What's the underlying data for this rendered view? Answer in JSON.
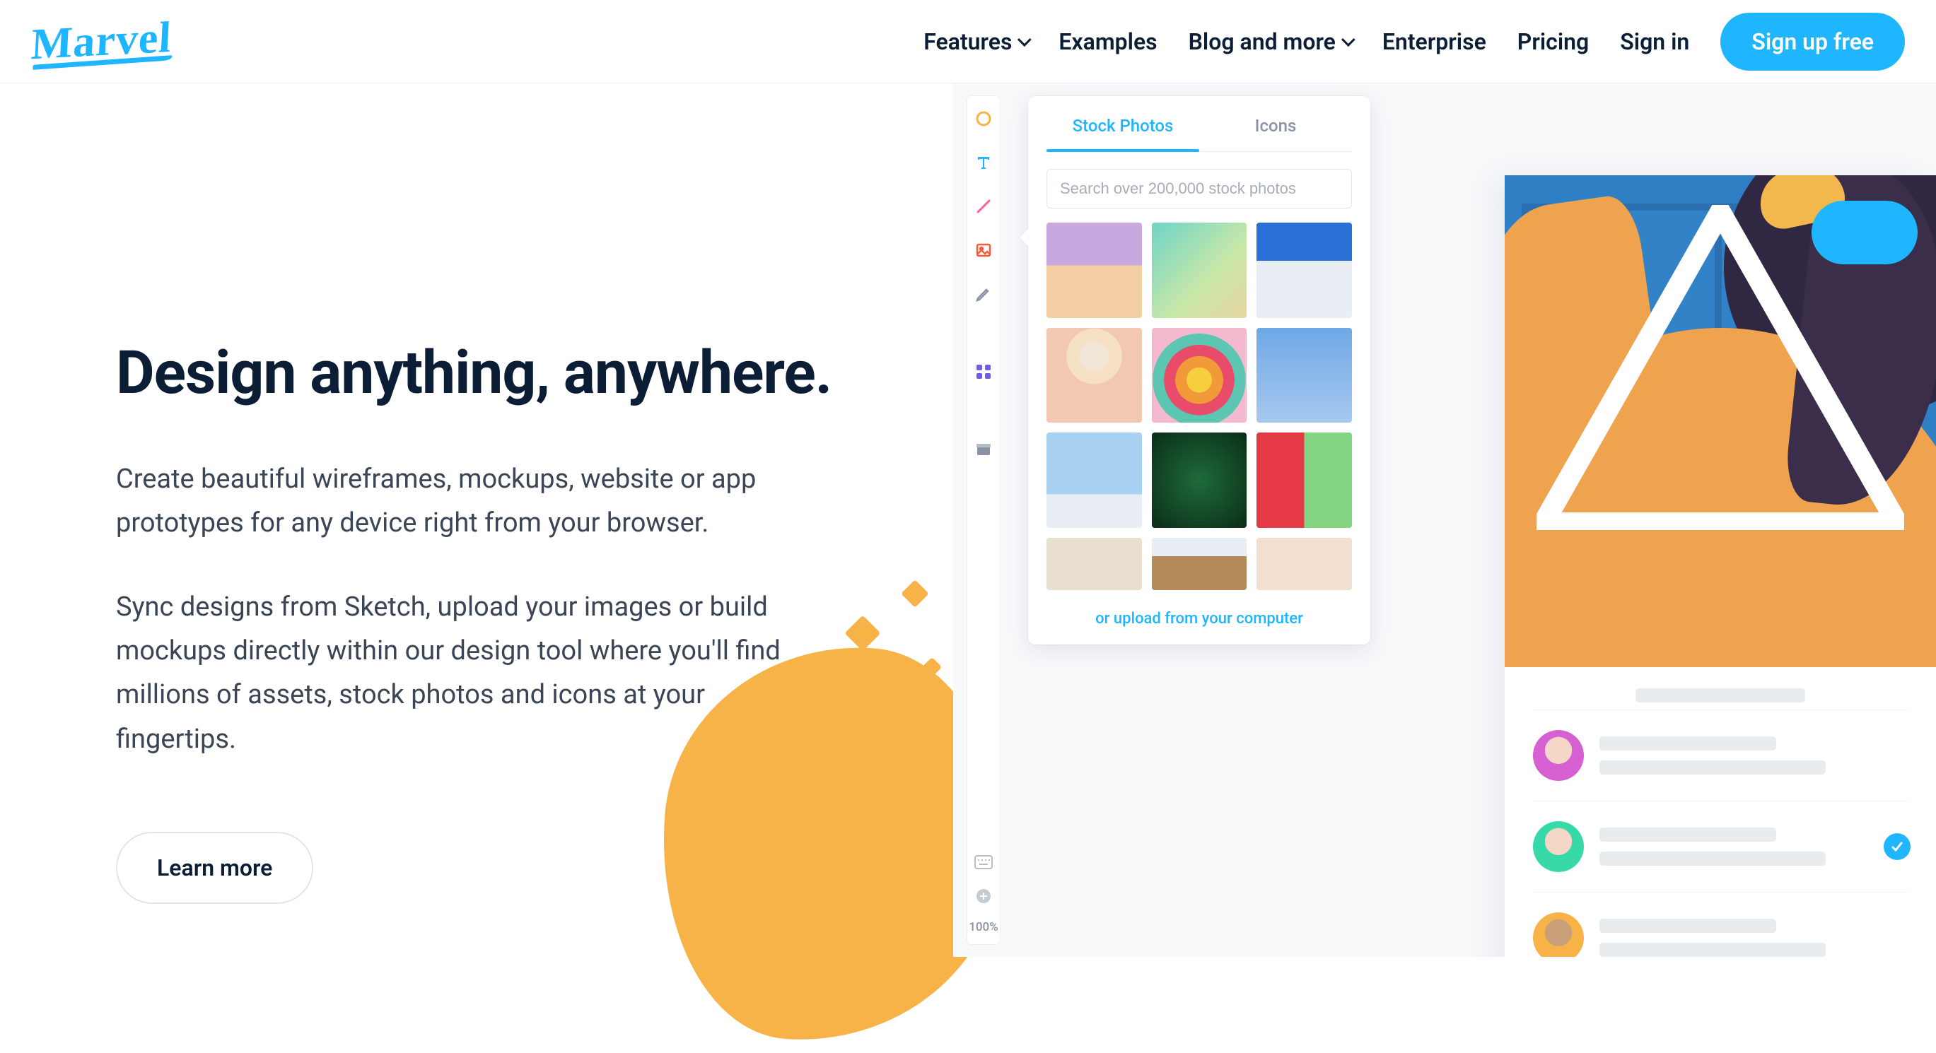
{
  "brand": "Marvel",
  "nav": {
    "features": "Features",
    "examples": "Examples",
    "blog": "Blog and more",
    "enterprise": "Enterprise",
    "pricing": "Pricing",
    "signin": "Sign in",
    "signup": "Sign up free"
  },
  "hero": {
    "title": "Design anything, anywhere.",
    "p1": "Create beautiful wireframes, mockups, website or app prototypes for any device right from your browser.",
    "p2": "Sync designs from Sketch, upload your images or build mockups directly within our design tool where you'll find millions of assets, stock photos and icons at your fingertips.",
    "cta": "Learn more"
  },
  "panel": {
    "tab_photos": "Stock Photos",
    "tab_icons": "Icons",
    "search_placeholder": "Search over 200,000 stock photos",
    "upload": "or upload from your computer"
  },
  "rail": {
    "zoom": "100%",
    "tools": [
      "shape",
      "text",
      "line",
      "image",
      "pencil",
      "swap",
      "components",
      "archive"
    ]
  },
  "colors": {
    "accent": "#1fb6ff",
    "orange": "#f7b348"
  }
}
